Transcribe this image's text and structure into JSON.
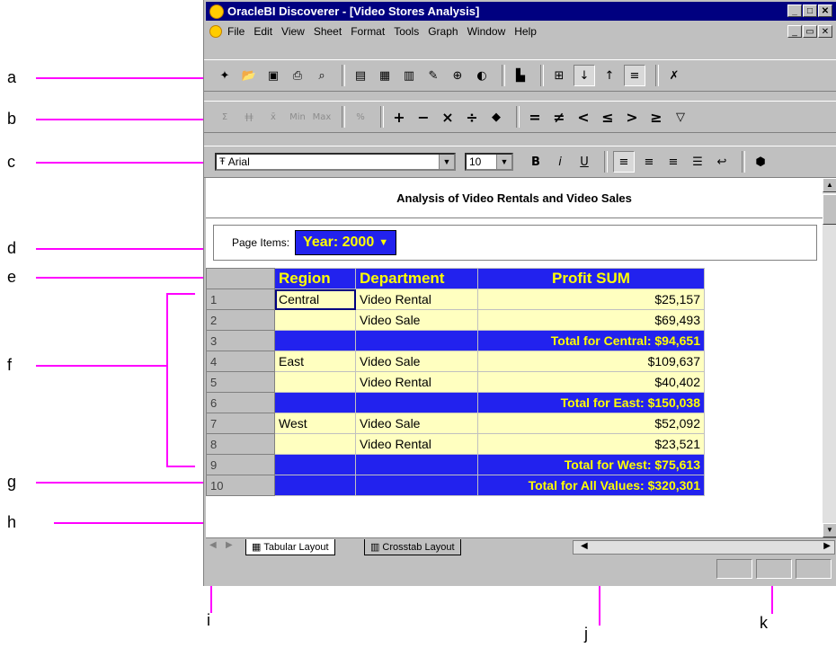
{
  "window": {
    "title": "OracleBI Discoverer - [Video Stores Analysis]"
  },
  "menu": [
    "File",
    "Edit",
    "View",
    "Sheet",
    "Format",
    "Tools",
    "Graph",
    "Window",
    "Help"
  ],
  "toolbar_b": {
    "min": "Min",
    "max": "Max"
  },
  "format_toolbar": {
    "font": "Arial",
    "size": "10"
  },
  "sheet": {
    "title": "Analysis of Video Rentals and Video Sales",
    "page_items_label": "Page Items:",
    "page_item_value": "Year: 2000",
    "columns": [
      "Region",
      "Department",
      "Profit SUM"
    ],
    "rows": [
      {
        "n": "1",
        "region": "Central",
        "dept": "Video Rental",
        "profit": "$25,157"
      },
      {
        "n": "2",
        "region": "",
        "dept": "Video Sale",
        "profit": "$69,493"
      },
      {
        "n": "3",
        "total": "Total for Central: $94,651"
      },
      {
        "n": "4",
        "region": "East",
        "dept": "Video Sale",
        "profit": "$109,637"
      },
      {
        "n": "5",
        "region": "",
        "dept": "Video Rental",
        "profit": "$40,402"
      },
      {
        "n": "6",
        "total": "Total for East: $150,038"
      },
      {
        "n": "7",
        "region": "West",
        "dept": "Video Sale",
        "profit": "$52,092"
      },
      {
        "n": "8",
        "region": "",
        "dept": "Video Rental",
        "profit": "$23,521"
      },
      {
        "n": "9",
        "total": "Total for West: $75,613"
      },
      {
        "n": "10",
        "total": "Total for All Values: $320,301"
      }
    ]
  },
  "tabs": [
    "Tabular Layout",
    "Crosstab Layout"
  ],
  "callouts": [
    "a",
    "b",
    "c",
    "d",
    "e",
    "f",
    "g",
    "h",
    "i",
    "j",
    "k"
  ],
  "colors": {
    "callout": "#ff00ff",
    "header_bg": "#2222ee",
    "header_text": "#ffff00",
    "cell_bg": "#ffffc0"
  }
}
